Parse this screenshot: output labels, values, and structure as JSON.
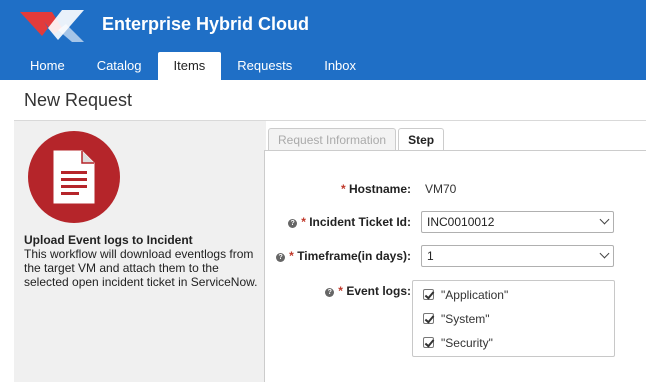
{
  "header": {
    "brand": "Enterprise Hybrid Cloud",
    "nav": [
      "Home",
      "Catalog",
      "Items",
      "Requests",
      "Inbox"
    ],
    "active_nav": "Items"
  },
  "page": {
    "title": "New Request"
  },
  "item": {
    "icon": "document-icon",
    "title": "Upload Event logs to Incident",
    "description": "This workflow will download eventlogs from the target VM and attach them to the selected open incident ticket in ServiceNow."
  },
  "tabs": [
    "Request Information",
    "Step"
  ],
  "active_tab": "Step",
  "form": {
    "hostname_label": "Hostname:",
    "hostname_value": "VM70",
    "ticket_label": "Incident Ticket Id:",
    "ticket_value": "INC0010012",
    "timeframe_label": "Timeframe(in days):",
    "timeframe_value": "1",
    "eventlogs_label": "Event logs:",
    "eventlogs": [
      "\"Application\"",
      "\"System\"",
      "\"Security\""
    ]
  },
  "colors": {
    "header": "#1f6fc6",
    "icon_circle": "#b5252a",
    "required_star": "#c0392b"
  }
}
